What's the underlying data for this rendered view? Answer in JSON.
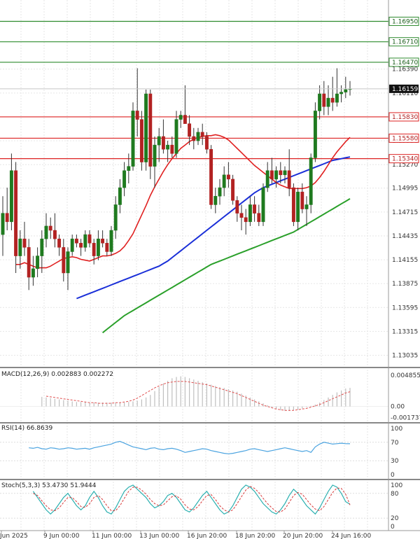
{
  "chart_data": {
    "type": "candlestick",
    "price_panel": {
      "y_ticks": [
        1.1639,
        1.1611,
        1.1583,
        1.1555,
        1.1527,
        1.14995,
        1.14715,
        1.14435,
        1.14155,
        1.13875,
        1.13595,
        1.13315,
        1.13035
      ],
      "y_tick_labels": [
        "1.16390",
        "1.16110",
        "1.15830",
        "1.15550",
        "1.15270",
        "1.14995",
        "1.14715",
        "1.14435",
        "1.14155",
        "1.13875",
        "1.13595",
        "1.13315",
        "1.13035"
      ],
      "ylim": [
        1.129,
        1.172
      ],
      "resistance_levels": [
        1.1695,
        1.1671,
        1.1647
      ],
      "resistance_labels": [
        "1.16950",
        "1.16710",
        "1.16470"
      ],
      "support_levels": [
        1.1583,
        1.1558,
        1.1534
      ],
      "support_labels": [
        "1.15830",
        "1.15580",
        "1.15340"
      ],
      "current_price": 1.16159,
      "current_price_label": "1.16159",
      "candles": [
        [
          1.1445,
          1.149,
          1.142,
          1.147
        ],
        [
          1.147,
          1.15,
          1.145,
          1.146
        ],
        [
          1.146,
          1.154,
          1.145,
          1.152
        ],
        [
          1.152,
          1.153,
          1.14,
          1.142
        ],
        [
          1.142,
          1.145,
          1.1405,
          1.144
        ],
        [
          1.144,
          1.146,
          1.142,
          1.143
        ],
        [
          1.143,
          1.144,
          1.138,
          1.1395
        ],
        [
          1.1395,
          1.142,
          1.1385,
          1.1405
        ],
        [
          1.1405,
          1.143,
          1.1395,
          1.142
        ],
        [
          1.142,
          1.145,
          1.14,
          1.144
        ],
        [
          1.144,
          1.147,
          1.143,
          1.1455
        ],
        [
          1.1455,
          1.1465,
          1.144,
          1.145
        ],
        [
          1.145,
          1.147,
          1.143,
          1.144
        ],
        [
          1.144,
          1.1445,
          1.142,
          1.143
        ],
        [
          1.143,
          1.144,
          1.139,
          1.14
        ],
        [
          1.14,
          1.143,
          1.138,
          1.1425
        ],
        [
          1.1425,
          1.1445,
          1.142,
          1.144
        ],
        [
          1.144,
          1.1445,
          1.143,
          1.1435
        ],
        [
          1.1435,
          1.144,
          1.142,
          1.143
        ],
        [
          1.143,
          1.145,
          1.1425,
          1.1445
        ],
        [
          1.1445,
          1.145,
          1.143,
          1.1435
        ],
        [
          1.1435,
          1.144,
          1.141,
          1.142
        ],
        [
          1.142,
          1.145,
          1.1415,
          1.144
        ],
        [
          1.144,
          1.145,
          1.143,
          1.1435
        ],
        [
          1.1435,
          1.144,
          1.142,
          1.1425
        ],
        [
          1.1425,
          1.1455,
          1.142,
          1.145
        ],
        [
          1.145,
          1.149,
          1.144,
          1.148
        ],
        [
          1.148,
          1.151,
          1.147,
          1.15
        ],
        [
          1.15,
          1.153,
          1.149,
          1.152
        ],
        [
          1.152,
          1.154,
          1.1505,
          1.1525
        ],
        [
          1.1525,
          1.16,
          1.152,
          1.159
        ],
        [
          1.159,
          1.164,
          1.156,
          1.158
        ],
        [
          1.158,
          1.159,
          1.152,
          1.153
        ],
        [
          1.153,
          1.1615,
          1.152,
          1.161
        ],
        [
          1.161,
          1.1615,
          1.151,
          1.1525
        ],
        [
          1.1525,
          1.156,
          1.15,
          1.155
        ],
        [
          1.155,
          1.157,
          1.153,
          1.156
        ],
        [
          1.156,
          1.158,
          1.154,
          1.1545
        ],
        [
          1.1545,
          1.1555,
          1.153,
          1.155
        ],
        [
          1.155,
          1.156,
          1.1535,
          1.154
        ],
        [
          1.154,
          1.159,
          1.1535,
          1.158
        ],
        [
          1.158,
          1.159,
          1.157,
          1.1585
        ],
        [
          1.1585,
          1.162,
          1.158,
          1.1575
        ],
        [
          1.1575,
          1.1585,
          1.155,
          1.156
        ],
        [
          1.156,
          1.157,
          1.1545,
          1.1555
        ],
        [
          1.1555,
          1.157,
          1.155,
          1.1565
        ],
        [
          1.1565,
          1.1575,
          1.155,
          1.156
        ],
        [
          1.156,
          1.1565,
          1.154,
          1.1545
        ],
        [
          1.1545,
          1.155,
          1.1475,
          1.148
        ],
        [
          1.148,
          1.15,
          1.147,
          1.149
        ],
        [
          1.149,
          1.151,
          1.148,
          1.15
        ],
        [
          1.15,
          1.1525,
          1.149,
          1.1515
        ],
        [
          1.1515,
          1.153,
          1.15,
          1.151
        ],
        [
          1.151,
          1.1515,
          1.148,
          1.1485
        ],
        [
          1.1485,
          1.149,
          1.146,
          1.147
        ],
        [
          1.147,
          1.148,
          1.145,
          1.1465
        ],
        [
          1.1465,
          1.1475,
          1.1445,
          1.146
        ],
        [
          1.146,
          1.149,
          1.1455,
          1.148
        ],
        [
          1.148,
          1.149,
          1.146,
          1.147
        ],
        [
          1.147,
          1.148,
          1.1455,
          1.146
        ],
        [
          1.146,
          1.1505,
          1.1455,
          1.15
        ],
        [
          1.15,
          1.153,
          1.1495,
          1.152
        ],
        [
          1.152,
          1.1535,
          1.1505,
          1.151
        ],
        [
          1.151,
          1.1525,
          1.15,
          1.152
        ],
        [
          1.152,
          1.153,
          1.1505,
          1.1515
        ],
        [
          1.1515,
          1.1525,
          1.1505,
          1.152
        ],
        [
          1.152,
          1.1545,
          1.149,
          1.15
        ],
        [
          1.15,
          1.1505,
          1.1455,
          1.146
        ],
        [
          1.146,
          1.15,
          1.145,
          1.1495
        ],
        [
          1.1495,
          1.1505,
          1.147,
          1.1475
        ],
        [
          1.1475,
          1.149,
          1.1455,
          1.148
        ],
        [
          1.148,
          1.154,
          1.147,
          1.1535
        ],
        [
          1.1535,
          1.16,
          1.153,
          1.159
        ],
        [
          1.159,
          1.162,
          1.158,
          1.161
        ],
        [
          1.161,
          1.1625,
          1.1585,
          1.1595
        ],
        [
          1.1595,
          1.162,
          1.1585,
          1.1605
        ],
        [
          1.1605,
          1.163,
          1.159,
          1.16
        ],
        [
          1.16,
          1.164,
          1.1595,
          1.161
        ],
        [
          1.161,
          1.162,
          1.16,
          1.1612
        ],
        [
          1.1612,
          1.163,
          1.1605,
          1.1615
        ],
        [
          1.1615,
          1.1625,
          1.1608,
          1.1616
        ]
      ],
      "ma_red": [
        1.141,
        1.141,
        1.1412,
        1.141,
        1.1408,
        1.1406,
        1.1406,
        1.1406,
        1.1408,
        1.1411,
        1.1414,
        1.1417,
        1.1418,
        1.1419,
        1.1418,
        1.1416,
        1.1415,
        1.1414,
        1.1416,
        1.1418,
        1.142,
        1.142,
        1.1421,
        1.1423,
        1.1426,
        1.1431,
        1.1438,
        1.1446,
        1.1457,
        1.1468,
        1.1479,
        1.1491,
        1.1501,
        1.151,
        1.1519,
        1.1527,
        1.1534,
        1.154,
        1.1546,
        1.155,
        1.1554,
        1.1557,
        1.1559,
        1.156,
        1.1561,
        1.1561,
        1.1562,
        1.1561,
        1.1559,
        1.1556,
        1.1551,
        1.1546,
        1.1541,
        1.1536,
        1.1531,
        1.1526,
        1.1522,
        1.1518,
        1.1514,
        1.151,
        1.1506,
        1.1503,
        1.1501,
        1.1499,
        1.1499,
        1.1499,
        1.1499,
        1.15,
        1.1502,
        1.1506,
        1.1512,
        1.1519,
        1.1527,
        1.1535,
        1.1542,
        1.1548,
        1.1554,
        1.1559
      ],
      "ma_blue": [
        1.137,
        1.1372,
        1.1374,
        1.1376,
        1.1378,
        1.138,
        1.1382,
        1.1384,
        1.1386,
        1.1388,
        1.139,
        1.1392,
        1.1394,
        1.1396,
        1.1398,
        1.14,
        1.1402,
        1.1404,
        1.1406,
        1.1408,
        1.1411,
        1.1414,
        1.1418,
        1.1422,
        1.1426,
        1.143,
        1.1434,
        1.1438,
        1.1442,
        1.1446,
        1.145,
        1.1454,
        1.1458,
        1.1462,
        1.1466,
        1.147,
        1.1474,
        1.1478,
        1.1482,
        1.1486,
        1.149,
        1.1494,
        1.1497,
        1.15,
        1.1502,
        1.1504,
        1.1506,
        1.1508,
        1.151,
        1.1512,
        1.1514,
        1.1516,
        1.1518,
        1.152,
        1.1522,
        1.1524,
        1.1526,
        1.1528,
        1.153,
        1.1532,
        1.1533,
        1.1534,
        1.1535,
        1.1536
      ],
      "ma_green": [
        1.133,
        1.1334,
        1.1338,
        1.1342,
        1.1346,
        1.135,
        1.1353,
        1.1356,
        1.1359,
        1.1362,
        1.1365,
        1.1368,
        1.1371,
        1.1374,
        1.1377,
        1.138,
        1.1383,
        1.1386,
        1.1389,
        1.1392,
        1.1395,
        1.1398,
        1.1401,
        1.1404,
        1.1407,
        1.141,
        1.1412,
        1.1414,
        1.1416,
        1.1418,
        1.142,
        1.1422,
        1.1424,
        1.1426,
        1.1428,
        1.143,
        1.1432,
        1.1434,
        1.1436,
        1.1438,
        1.144,
        1.1442,
        1.1444,
        1.1446,
        1.1448,
        1.1451,
        1.1454,
        1.1457,
        1.146,
        1.1463,
        1.1466,
        1.1469,
        1.1472,
        1.1475,
        1.1478,
        1.1481,
        1.1484,
        1.1487
      ]
    },
    "macd_panel": {
      "label": "MACD(12,26,9) 0.002883 0.002272",
      "y_tick_labels": [
        "0.004855",
        "0.00",
        "-0.001737"
      ],
      "ylim": [
        -0.002,
        0.0052
      ],
      "histogram": [
        0.0015,
        0.0014,
        0.0013,
        0.0012,
        0.0011,
        0.001,
        0.0009,
        0.0008,
        0.0007,
        0.0007,
        0.0007,
        0.0006,
        0.0006,
        0.0006,
        0.0006,
        0.0006,
        0.0006,
        0.0006,
        0.0006,
        0.0006,
        0.0007,
        0.0008,
        0.0009,
        0.0011,
        0.0014,
        0.0018,
        0.0024,
        0.003,
        0.0036,
        0.004,
        0.0044,
        0.0046,
        0.0047,
        0.0046,
        0.0044,
        0.0042,
        0.004,
        0.0038,
        0.0036,
        0.0034,
        0.0032,
        0.003,
        0.0029,
        0.0027,
        0.0025,
        0.0023,
        0.002,
        0.0017,
        0.0014,
        0.0011,
        0.0008,
        0.0005,
        0.0002,
        -0.0002,
        -0.0004,
        -0.0006,
        -0.0007,
        -0.0007,
        -0.0006,
        -0.0005,
        -0.0003,
        -0.0001,
        0.0001,
        0.0003,
        0.0006,
        0.001,
        0.0014,
        0.0018,
        0.0022,
        0.0025,
        0.0028,
        0.0029
      ],
      "signal": [
        0.0016,
        0.0015,
        0.0014,
        0.0013,
        0.0012,
        0.0011,
        0.001,
        0.0009,
        0.0008,
        0.0007,
        0.0006,
        0.0006,
        0.0005,
        0.0005,
        0.0005,
        0.0005,
        0.0006,
        0.0006,
        0.0007,
        0.0008,
        0.001,
        0.0013,
        0.0017,
        0.0021,
        0.0025,
        0.0029,
        0.0032,
        0.0035,
        0.0037,
        0.0038,
        0.0039,
        0.0039,
        0.0039,
        0.0038,
        0.0037,
        0.0036,
        0.0035,
        0.0034,
        0.0032,
        0.003,
        0.0028,
        0.0026,
        0.0024,
        0.0022,
        0.002,
        0.0017,
        0.0014,
        0.0011,
        0.0008,
        0.0005,
        0.0002,
        0.0,
        -0.0002,
        -0.0004,
        -0.0005,
        -0.0006,
        -0.0006,
        -0.0006,
        -0.0005,
        -0.0004,
        -0.0003,
        -0.0001,
        0.0001,
        0.0003,
        0.0006,
        0.0009,
        0.0012,
        0.0015,
        0.0018,
        0.0021,
        0.0023
      ]
    },
    "rsi_panel": {
      "label": "RSI(14) 66.8639",
      "y_tick_labels": [
        "100",
        "70",
        "30",
        "0"
      ],
      "ylim": [
        0,
        100
      ],
      "values": [
        58,
        57,
        59,
        56,
        55,
        58,
        57,
        55,
        56,
        58,
        57,
        55,
        56,
        57,
        55,
        58,
        60,
        62,
        64,
        66,
        70,
        72,
        68,
        64,
        60,
        58,
        56,
        54,
        57,
        58,
        55,
        54,
        56,
        57,
        55,
        52,
        48,
        50,
        52,
        54,
        56,
        55,
        52,
        50,
        48,
        46,
        45,
        46,
        48,
        50,
        52,
        55,
        56,
        54,
        52,
        50,
        52,
        54,
        56,
        58,
        56,
        54,
        52,
        50,
        52,
        48,
        60,
        66,
        70,
        68,
        66,
        67,
        68,
        67,
        66.86
      ]
    },
    "stoch_panel": {
      "label": "Stoch(5,3,3) 53.4730 51.9444",
      "y_tick_labels": [
        "100",
        "80",
        "20",
        "0"
      ],
      "ylim": [
        0,
        100
      ],
      "k": [
        85,
        70,
        55,
        40,
        30,
        40,
        55,
        70,
        80,
        65,
        50,
        40,
        50,
        70,
        85,
        70,
        50,
        35,
        30,
        45,
        65,
        85,
        95,
        100,
        90,
        80,
        70,
        55,
        45,
        50,
        60,
        75,
        80,
        70,
        55,
        40,
        35,
        45,
        60,
        75,
        85,
        70,
        55,
        40,
        30,
        35,
        50,
        70,
        90,
        100,
        95,
        85,
        70,
        55,
        45,
        35,
        30,
        40,
        55,
        75,
        90,
        80,
        65,
        50,
        40,
        30,
        45,
        65,
        85,
        100,
        95,
        80,
        60,
        53.47
      ],
      "d": [
        80,
        75,
        62,
        50,
        40,
        38,
        45,
        58,
        70,
        70,
        60,
        48,
        46,
        55,
        70,
        75,
        65,
        50,
        38,
        38,
        50,
        68,
        85,
        95,
        95,
        88,
        78,
        65,
        55,
        50,
        52,
        62,
        72,
        74,
        66,
        52,
        42,
        40,
        48,
        62,
        75,
        77,
        65,
        50,
        40,
        35,
        40,
        55,
        72,
        88,
        97,
        92,
        82,
        68,
        55,
        45,
        36,
        35,
        42,
        58,
        75,
        82,
        78,
        65,
        52,
        42,
        38,
        48,
        65,
        82,
        93,
        92,
        78,
        51.94
      ]
    },
    "x_tick_labels": [
      "Jun 2025",
      "9 Jun 00:00",
      "11 Jun 00:00",
      "13 Jun 00:00",
      "16 Jun 20:00",
      "18 Jun 20:00",
      "20 Jun 20:00",
      "24 Jun 16:00"
    ],
    "colors": {
      "bull": "#1f7a1f",
      "bear": "#b22222",
      "resistance": "#2e8b2e",
      "support": "#dd2222",
      "ma_red": "#e02020",
      "ma_blue": "#1a2fd8",
      "ma_green": "#2aa02a",
      "macd_hist": "#bfbfbf",
      "macd_signal": "#e05050",
      "rsi": "#4aa3e0",
      "stoch_k": "#2bb0b0",
      "stoch_d": "#d83a3a"
    }
  }
}
